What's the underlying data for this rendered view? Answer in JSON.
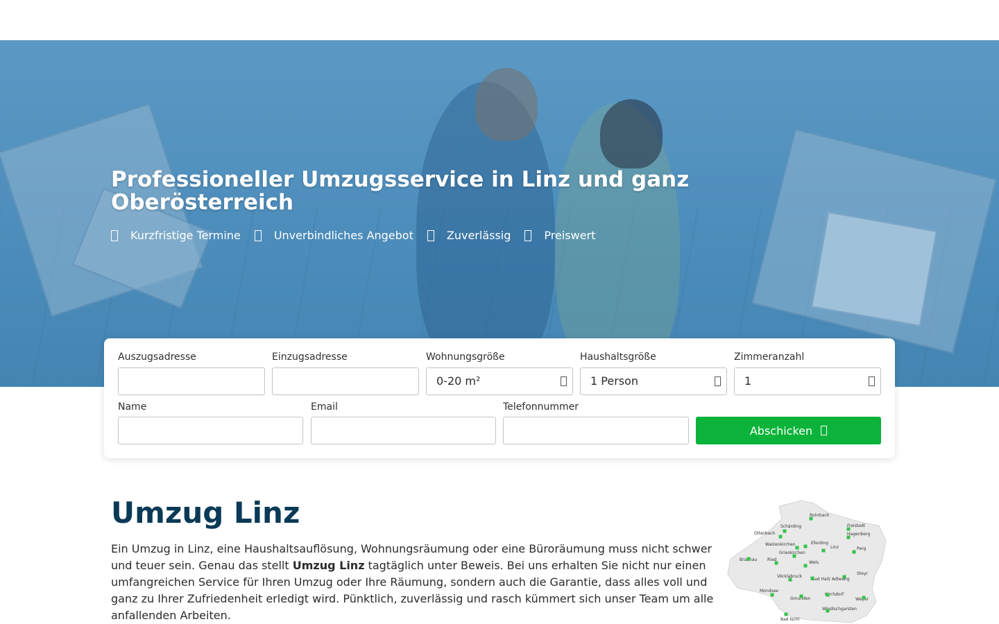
{
  "hero": {
    "title": "Professioneller Umzugsservice in Linz und ganz Oberösterreich",
    "features": [
      "Kurzfristige Termine",
      "Unverbindliches Angebot",
      "Zuverlässig",
      "Preiswert"
    ],
    "feature_icon": "check-icon"
  },
  "form": {
    "fields": {
      "auszug_label": "Auszugsadresse",
      "einzug_label": "Einzugsadresse",
      "wohnung_label": "Wohnungsgröße",
      "wohnung_value": "0-20 m²",
      "haushalt_label": "Haushaltsgröße",
      "haushalt_value": "1 Person",
      "zimmer_label": "Zimmeranzahl",
      "zimmer_value": "1",
      "name_label": "Name",
      "email_label": "Email",
      "telefon_label": "Telefonnummer"
    },
    "submit_label": "Abschicken",
    "submit_color": "#0bb33a",
    "select_icon": "chevron-down-icon",
    "submit_icon": "arrow-right-icon"
  },
  "content": {
    "title": "Umzug Linz",
    "paragraph_before": "Ein Umzug in Linz, eine Haushaltsauflösung, Wohnungsräumung oder eine Büroräumung muss nicht schwer und teuer sein. Genau das stellt ",
    "paragraph_bold": "Umzug Linz",
    "paragraph_after": " tagtäglich unter Beweis. Bei uns erhalten Sie nicht nur einen umfangreichen Service für Ihren Umzug oder Ihre Räumung, sondern auch die Garantie, dass alles voll und ganz zu Ihrer Zufriedenheit erledigt wird. Pünktlich, zuverlässig und rasch kümmert sich unser Team um alle anfallenden Arbeiten."
  },
  "map": {
    "cities": [
      "Rohrbach",
      "Freistadt",
      "Schärding",
      "Hagenberg",
      "Otterbach",
      "Eferding",
      "Waizenkirchen",
      "Linz",
      "Perg",
      "Grieskirchen",
      "Braunau",
      "Ried",
      "Wels",
      "Steyr",
      "Vöcklabruck",
      "Bad Hall/ Adlwang",
      "Mondsee",
      "Gmunden",
      "Kirchdorf",
      "Weyer",
      "Windischgarsten",
      "Bad Ischl"
    ],
    "marker_color": "#37c24a",
    "region_color": "#e9e9e9"
  },
  "colors": {
    "heading": "#0a3a57",
    "hero_overlay": "#5c9fcb"
  }
}
